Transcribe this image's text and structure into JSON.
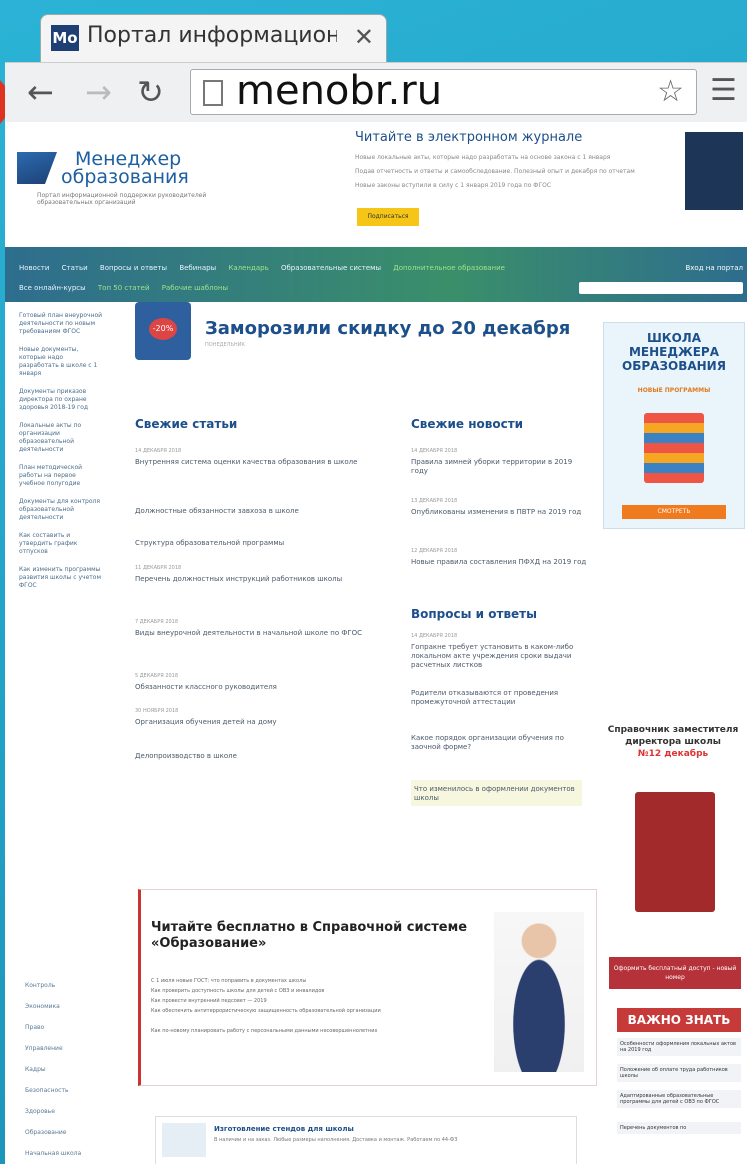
{
  "browser": {
    "tab_title": "Портал информационно",
    "tab_favicon": "Mo",
    "url": "menobr.ru"
  },
  "header": {
    "logo_line1": "Менеджер",
    "logo_line2": "образования",
    "logo_sub": "Портал информационной поддержки руководителей образовательных организаций",
    "promo_title": "Читайте в электронном журнале",
    "promo_lines": [
      "Новые локальные акты, которые надо разработать на основе закона с 1 января",
      "Подав отчетность и ответы и самообследование. Полезный опыт и декабря по отчетам",
      "Новые законы вступили в силу с 1 января 2019 года по ФГОС"
    ],
    "subscribe": "Подписаться"
  },
  "nav": {
    "row1": [
      "Новости",
      "Статьи",
      "Вопросы и ответы",
      "Вебинары",
      "Календарь",
      "Образовательные системы",
      "Дополнительное образование"
    ],
    "row2": [
      "Все онлайн-курсы",
      "Топ 50 статей",
      "Рабочие шаблоны"
    ],
    "right": "Вход на портал"
  },
  "sidebar": {
    "items": [
      "Готовый план внеурочной деятельности по новым требованиям ФГОС",
      "Новые документы, которые надо разработать в школе с 1 января",
      "Документы приказов директора по охране здоровья 2018-19 год",
      "Локальные акты по организации образовательной деятельности",
      "План методической работы на первое учебное полугодие",
      "Документы для контроля образовательной деятельности",
      "Как составить и утвердить график отпусков",
      "Как изменить программы развития школы с учетом ФГОС"
    ],
    "nav": [
      "Контроль",
      "Экономика",
      "Право",
      "Управление",
      "Кадры",
      "Безопасность",
      "Здоровье",
      "Образование",
      "Начальная школа"
    ]
  },
  "main": {
    "hero_badge": "-20%",
    "hero_title": "Заморозили скидку до 20 декабря",
    "hero_date": "ПОНЕДЕЛЬНИК",
    "fresh_articles": "Свежие статьи",
    "fresh_news": "Свежие новости",
    "qa": "Вопросы и ответы",
    "articles": [
      {
        "date": "14 ДЕКАБРЯ 2018",
        "title": "Внутренняя система оценки качества образования в школе"
      },
      {
        "date": "",
        "title": "Должностные обязанности завхоза в школе"
      },
      {
        "date": "",
        "title": "Структура образовательной программы"
      },
      {
        "date": "11 ДЕКАБРЯ 2018",
        "title": "Перечень должностных инструкций работников школы"
      },
      {
        "date": "7 ДЕКАБРЯ 2018",
        "title": "Виды внеурочной деятельности в начальной школе по ФГОС"
      },
      {
        "date": "5 ДЕКАБРЯ 2018",
        "title": "Обязанности классного руководителя"
      },
      {
        "date": "30 НОЯБРЯ 2018",
        "title": "Организация обучения детей на дому"
      },
      {
        "date": "",
        "title": "Делопроизводство в школе"
      }
    ],
    "news": [
      {
        "date": "14 ДЕКАБРЯ 2018",
        "title": "Правила зимней уборки территории в 2019 году"
      },
      {
        "date": "13 ДЕКАБРЯ 2018",
        "title": "Опубликованы изменения в ПВТР на 2019 год"
      },
      {
        "date": "12 ДЕКАБРЯ 2018",
        "title": "Новые правила составления ПФХД на 2019 год"
      }
    ],
    "questions": [
      {
        "date": "14 ДЕКАБРЯ 2018",
        "title": "Гопракне требует установить в каком-либо локальном акте учреждения сроки выдачи расчетных листков"
      },
      {
        "date": "",
        "title": "Родители отказываются от проведения промежуточной аттестации"
      },
      {
        "date": "",
        "title": "Какое порядок организации обучения по заочной форме?"
      },
      {
        "date": "",
        "title": "Что изменилось в оформлении документов школы"
      }
    ]
  },
  "ad": {
    "title": "Читайте бесплатно в Справочной системе «Образование»",
    "bullets": [
      "С 1 июля новые ГОСТ: что поправить в документах школы",
      "Как проверить доступность школы для детей с ОВЗ и инвалидов",
      "Как провести внутренний педсовет — 2019",
      "Как обеспечить антитеррористическую защищенность образовательной организации",
      "Как по-новому планировать работу с персональными данными несовершеннолетних"
    ]
  },
  "bottom_ad": {
    "title": "Изготовление стендов для школы",
    "text": "В наличии и на заказ. Любые размеры наполнения. Доставка и монтаж. Работаем по 44-ФЗ"
  },
  "right": {
    "school_title": "ШКОЛА МЕНЕДЖЕРА ОБРАЗОВАНИЯ",
    "school_sub": "НОВЫЕ ПРОГРАММЫ",
    "school_btn": "СМОТРЕТЬ",
    "ref_title": "Справочник заместителя директора школы",
    "ref_issue": "№12 декабрь",
    "ref_btn": "Оформить бесплатный доступ - новый номер",
    "know_head": "ВАЖНО ЗНАТЬ",
    "know_items": [
      "Особенности оформления локальных актов на 2019 год",
      "Положение об оплате труда работников школы",
      "Адаптированные образовательные программы для детей с ОВЗ по ФГОС",
      "Перечень документов по"
    ]
  }
}
